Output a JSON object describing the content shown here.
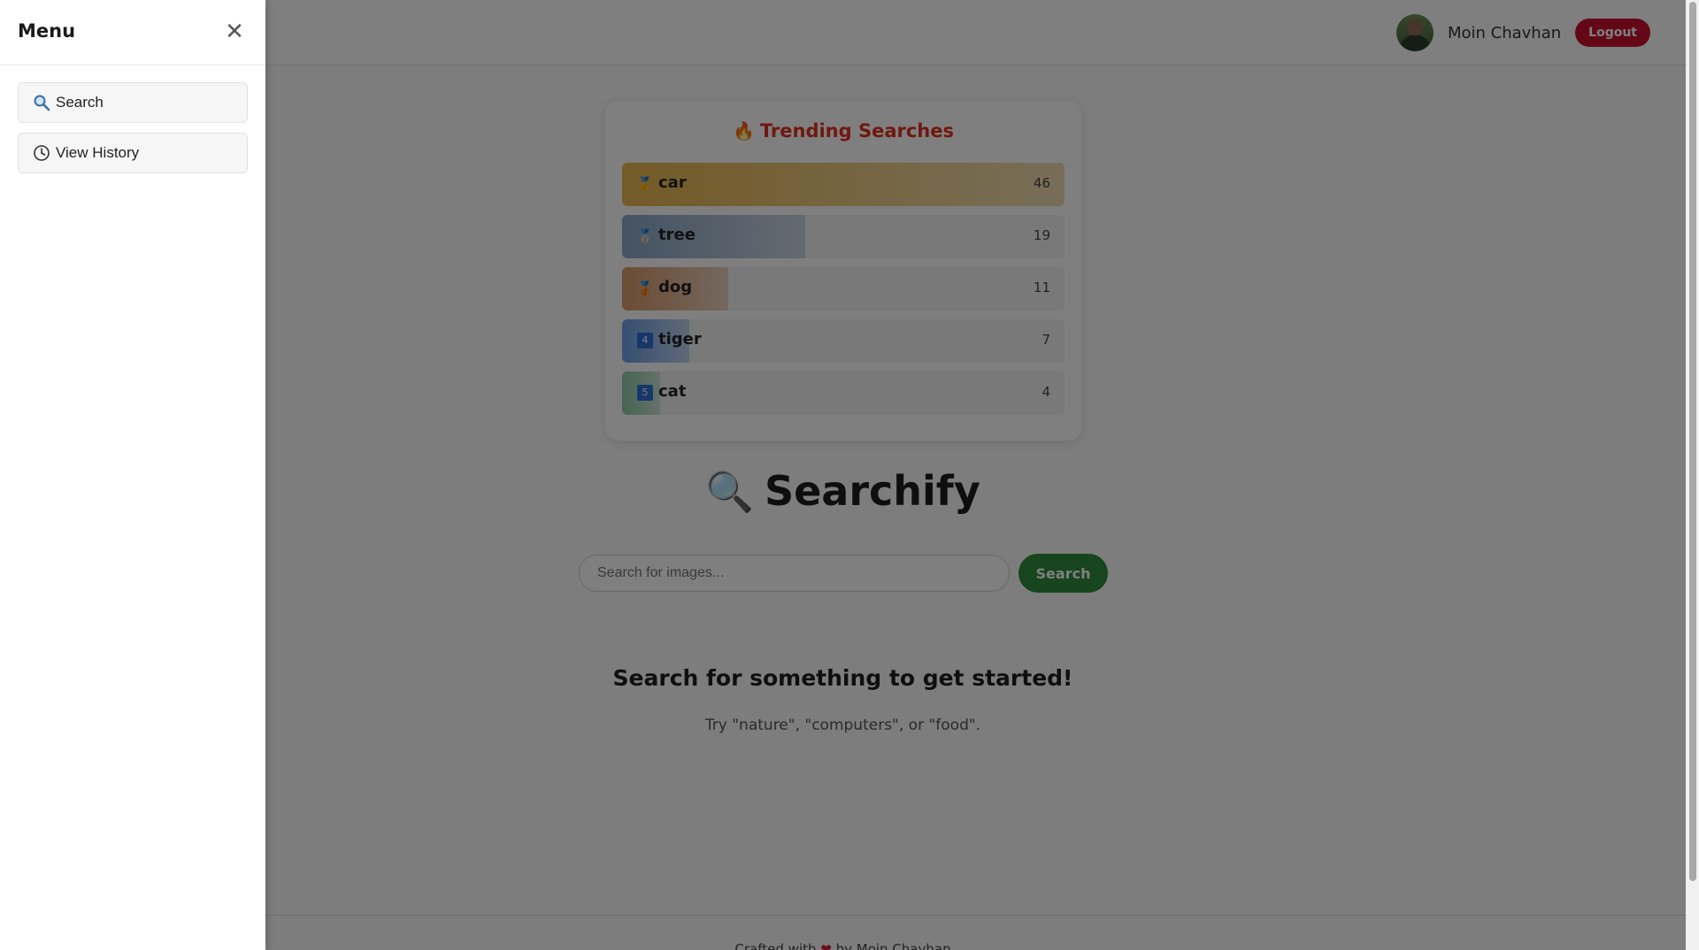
{
  "header": {
    "user_name": "Moin Chavhan",
    "logout_label": "Logout"
  },
  "trending": {
    "title": "Trending Searches",
    "items": [
      {
        "rank": "1",
        "term": "car",
        "count": 46,
        "color": "#e8b74f"
      },
      {
        "rank": "2",
        "term": "tree",
        "count": 19,
        "color": "#8aa7c6"
      },
      {
        "rank": "3",
        "term": "dog",
        "count": 11,
        "color": "#d99a6a"
      },
      {
        "rank": "4",
        "term": "tiger",
        "count": 7,
        "color": "#6fa0e6"
      },
      {
        "rank": "5",
        "term": "cat",
        "count": 4,
        "color": "#8fc9a8"
      }
    ]
  },
  "brand": {
    "name": "Searchify"
  },
  "search": {
    "placeholder": "Search for images...",
    "button_label": "Search"
  },
  "empty_state": {
    "title": "Search for something to get started!",
    "hint": "Try \"nature\", \"computers\", or \"food\"."
  },
  "footer": {
    "text_before": "Crafted with ",
    "text_after": " by Moin Chavhan"
  },
  "sidebar": {
    "title": "Menu",
    "items": [
      {
        "label": "Search",
        "icon": "search-icon"
      },
      {
        "label": "View History",
        "icon": "clock-icon"
      }
    ]
  }
}
